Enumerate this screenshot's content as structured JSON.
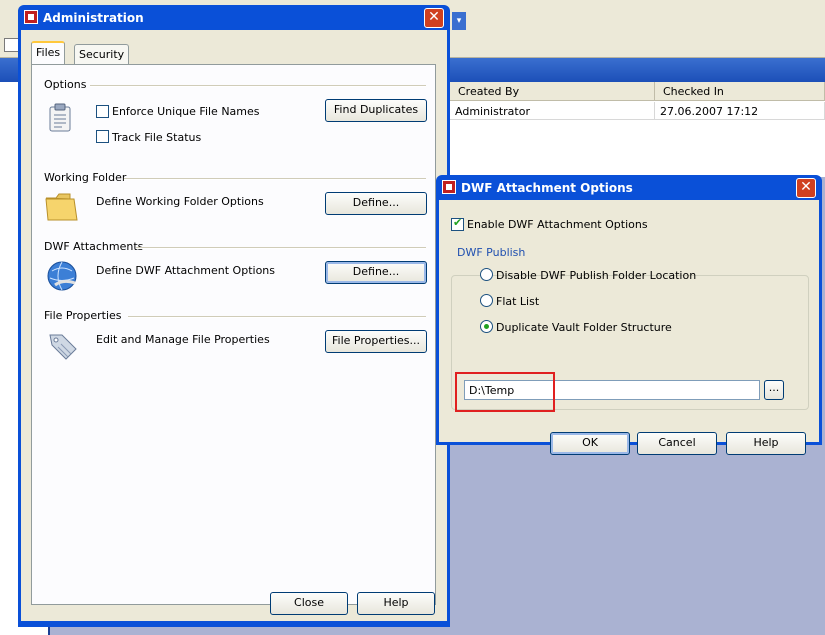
{
  "admin_window": {
    "title": "Administration",
    "tabs": [
      {
        "label": "Files"
      },
      {
        "label": "Security"
      }
    ],
    "sections": {
      "options": {
        "heading": "Options",
        "checkboxes": [
          {
            "label": "Enforce Unique File Names",
            "checked": false
          },
          {
            "label": "Track File Status",
            "checked": false
          }
        ],
        "button": "Find Duplicates"
      },
      "working_folder": {
        "heading": "Working Folder",
        "description": "Define Working Folder Options",
        "button": "Define..."
      },
      "dwf_attachments": {
        "heading": "DWF Attachments",
        "description": "Define DWF Attachment Options",
        "button": "Define..."
      },
      "file_properties": {
        "heading": "File Properties",
        "description": "Edit and Manage File Properties",
        "button": "File Properties..."
      }
    },
    "close_button": "Close",
    "help_button": "Help"
  },
  "dwf_window": {
    "title": "DWF Attachment Options",
    "enable_checkbox": {
      "label": "Enable DWF Attachment Options",
      "checked": true
    },
    "group_title": "DWF Publish",
    "radios": [
      {
        "label": "Disable DWF Publish Folder Location",
        "selected": false
      },
      {
        "label": "Flat List",
        "selected": false
      },
      {
        "label": "Duplicate Vault Folder Structure",
        "selected": true
      }
    ],
    "path_value": "D:\\Temp",
    "browse_button": "...",
    "ok_button": "OK",
    "cancel_button": "Cancel",
    "help_button": "Help"
  },
  "background_grid": {
    "columns": [
      "Created By",
      "Checked In"
    ],
    "rows": [
      [
        "Administrator",
        "27.06.2007 17:12"
      ]
    ]
  },
  "colors": {
    "title_bar": "#0a50d8",
    "dialog_bg": "#ece9d8",
    "highlight_box": "#e02020",
    "desktop": "#aab2d2"
  }
}
